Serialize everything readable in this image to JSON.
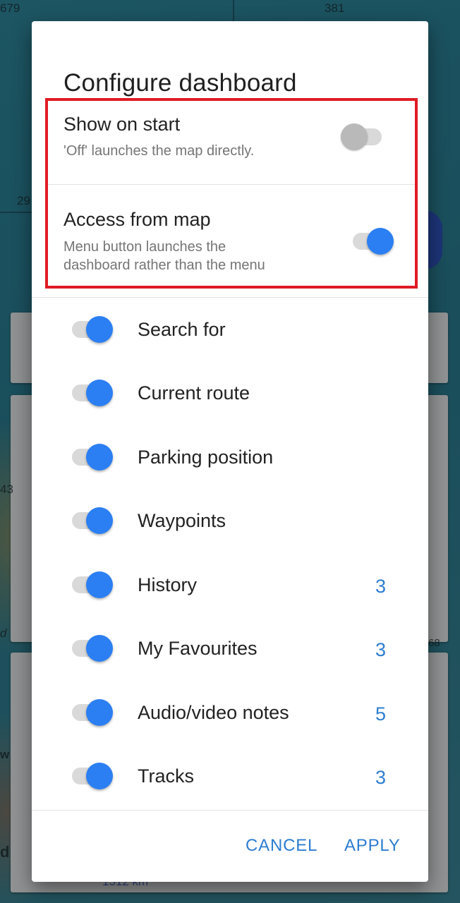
{
  "background": {
    "labels": [
      "679",
      "381",
      "29",
      "43",
      "d",
      "w",
      "d",
      "68",
      "1512 km"
    ]
  },
  "dialog": {
    "title": "Configure dashboard",
    "show_on_start": {
      "title": "Show on start",
      "summary": "'Off' launches the map directly.",
      "enabled": false
    },
    "access_from_map": {
      "title": "Access from map",
      "summary_line1": "Menu button launches the",
      "summary_line2": "dashboard rather than the menu",
      "enabled": true
    },
    "items": [
      {
        "label": "Search for",
        "count": "",
        "enabled": true
      },
      {
        "label": "Current route",
        "count": "",
        "enabled": true
      },
      {
        "label": "Parking position",
        "count": "",
        "enabled": true
      },
      {
        "label": "Waypoints",
        "count": "",
        "enabled": true
      },
      {
        "label": "History",
        "count": "3",
        "enabled": true
      },
      {
        "label": "My Favourites",
        "count": "3",
        "enabled": true
      },
      {
        "label": "Audio/video notes",
        "count": "5",
        "enabled": true
      },
      {
        "label": "Tracks",
        "count": "3",
        "enabled": true
      }
    ],
    "cancel_label": "CANCEL",
    "apply_label": "APPLY"
  },
  "colors": {
    "accent": "#2b7ff2",
    "action_text": "#2e7dd1",
    "highlight_border": "#e01b24"
  }
}
